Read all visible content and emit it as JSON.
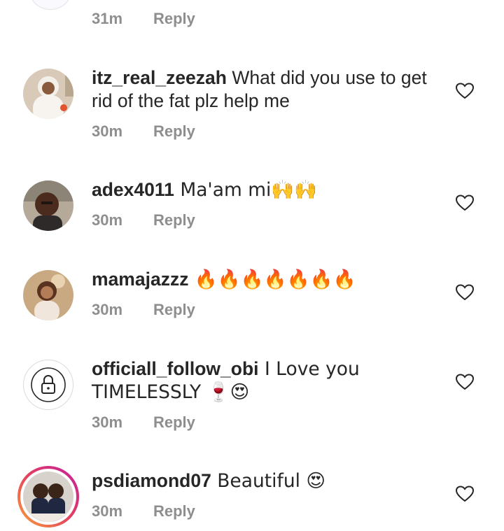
{
  "top": {
    "time": "31m",
    "reply": "Reply"
  },
  "comments": [
    {
      "username": "itz_real_zeezah",
      "text": " What did you use to get rid of the fat plz help me",
      "time": "30m",
      "reply": "Reply"
    },
    {
      "username": "adex4011",
      "text": " Ma'am mi🙌🙌",
      "time": "30m",
      "reply": "Reply"
    },
    {
      "username": "mamajazzz",
      "text": " 🔥🔥🔥🔥🔥🔥🔥",
      "time": "30m",
      "reply": "Reply"
    },
    {
      "username": "officiall_follow_obi",
      "text": " I Love you TIMELESSLY 🍷😍",
      "time": "30m",
      "reply": "Reply"
    },
    {
      "username": "psdiamond07",
      "text": " Beautiful 😍",
      "time": "30m",
      "reply": "Reply"
    }
  ],
  "icons": {
    "like": "heart-outline-icon",
    "private_avatar": "lock-icon"
  },
  "colors": {
    "text": "#262626",
    "muted": "#8e8e8e",
    "story_ring_start": "#f9a43a",
    "story_ring_end": "#c21fa0"
  }
}
